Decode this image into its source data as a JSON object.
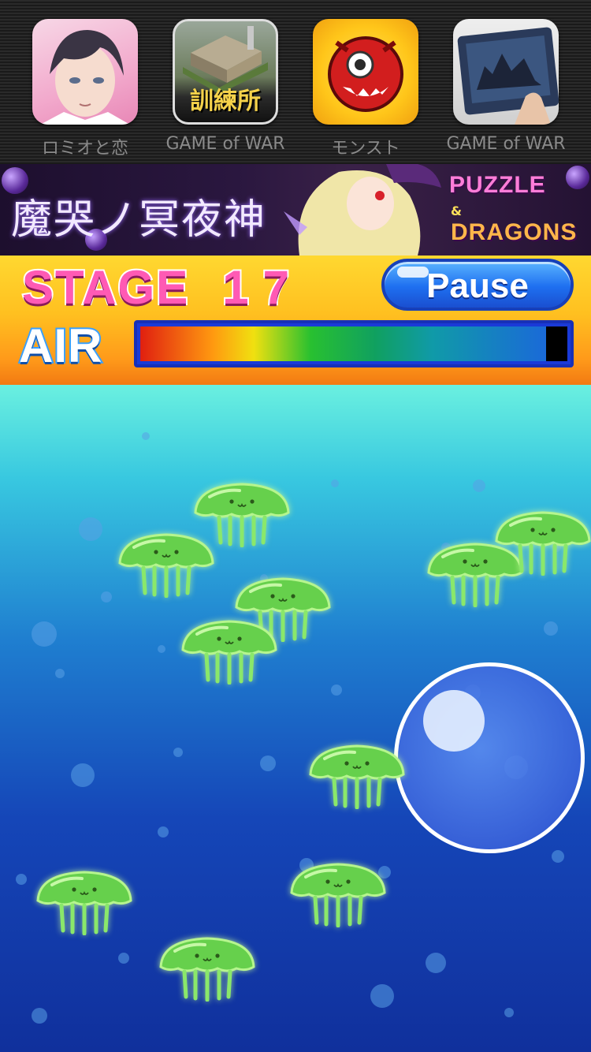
{
  "app_ads": [
    {
      "label": "ロミオと恋",
      "icon": "anime-boy-icon"
    },
    {
      "label": "GAME of WAR",
      "icon": "training-camp-icon",
      "tile_text": "訓練所"
    },
    {
      "label": "モンスト",
      "icon": "red-dragon-icon"
    },
    {
      "label": "GAME of WAR",
      "icon": "castle-tablet-icon"
    }
  ],
  "banner": {
    "title_jp": "魔哭ノ冥夜神",
    "brand_line1": "PUZZLE",
    "brand_amp": "&",
    "brand_line2": "DRAGONS"
  },
  "hud": {
    "stage_label": "STAGE",
    "stage_number": "17",
    "pause_label": "Pause",
    "air_label": "AIR",
    "air_level": 0.95
  },
  "colors": {
    "stage_text": "#ff5ab4",
    "pause_button": "#1e6ff0",
    "jellyfish": "#5fd04a",
    "water_top": "#6af0e0",
    "water_bottom": "#10309c"
  },
  "jellyfish_count": 11
}
